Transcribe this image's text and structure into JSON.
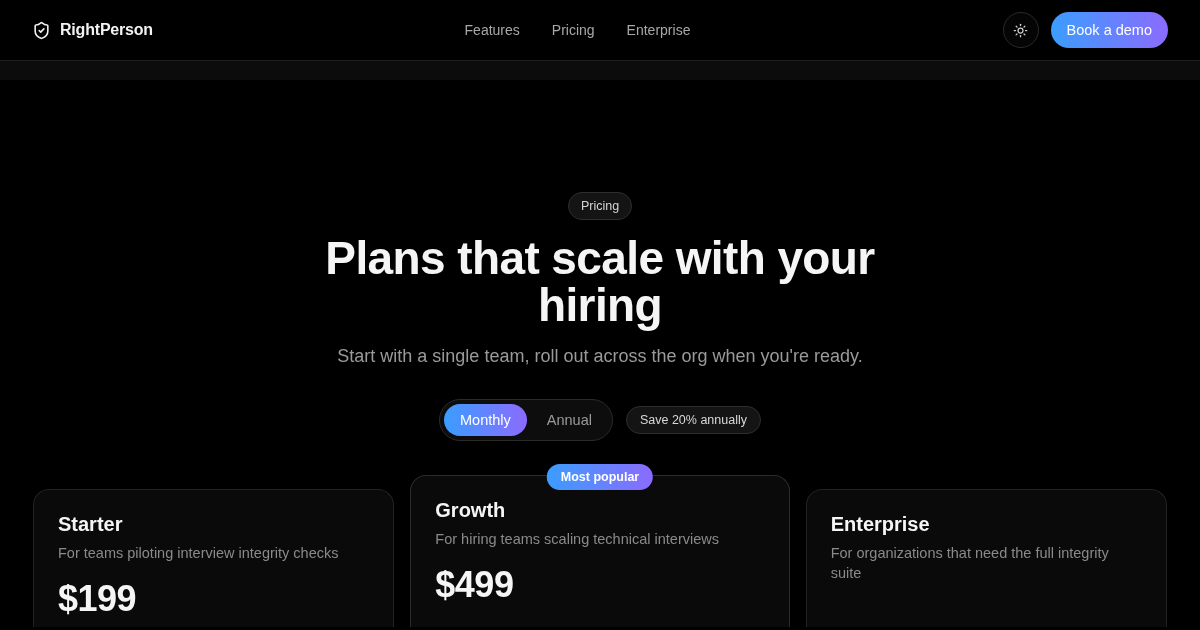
{
  "nav": {
    "brand": "RightPerson",
    "links": [
      {
        "label": "Features"
      },
      {
        "label": "Pricing"
      },
      {
        "label": "Enterprise"
      }
    ],
    "cta": "Book a demo"
  },
  "hero": {
    "badge": "Pricing",
    "title": "Plans that scale with your hiring",
    "subtitle": "Start with a single team, roll out across the org when you're ready."
  },
  "billing": {
    "options": [
      {
        "label": "Monthly",
        "selected": true
      },
      {
        "label": "Annual",
        "selected": false
      }
    ],
    "note": "Save 20% annually"
  },
  "plans": [
    {
      "name": "Starter",
      "description": "For teams piloting interview integrity checks",
      "price": "$199",
      "featured": false
    },
    {
      "name": "Growth",
      "badge": "Most popular",
      "description": "For hiring teams scaling technical interviews",
      "price": "$499",
      "featured": true
    },
    {
      "name": "Enterprise",
      "description": "For organizations that need the full integrity suite",
      "featured": false
    }
  ]
}
